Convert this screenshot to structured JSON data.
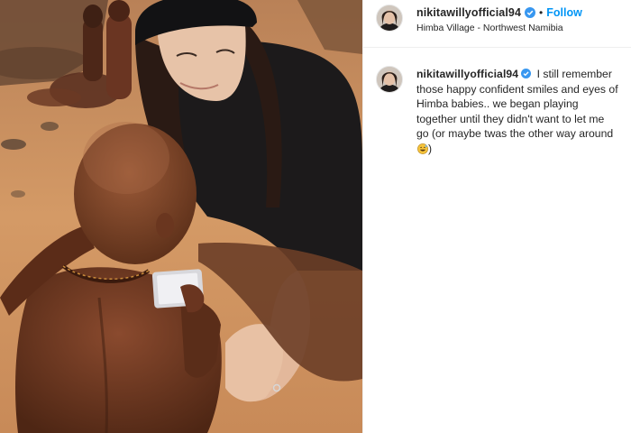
{
  "post": {
    "username": "nikitawillyofficial94",
    "separator": "•",
    "follow_label": "Follow",
    "location": "Himba Village - Northwest Namibia"
  },
  "caption": {
    "username": "nikitawillyofficial94",
    "text": "I still remember those happy confident smiles and eyes of Himba babies.. we began playing together until they didn't want to let me go (or maybe twas the other way around",
    "text_end": ")",
    "emoji": "grinning-sweat-emoji"
  },
  "icons": {
    "verified": "verified-badge-icon",
    "avatar": "profile-avatar"
  },
  "colors": {
    "link_blue": "#0095f6",
    "verified_blue": "#3897f0",
    "text": "#262626",
    "divider": "#efefef"
  }
}
